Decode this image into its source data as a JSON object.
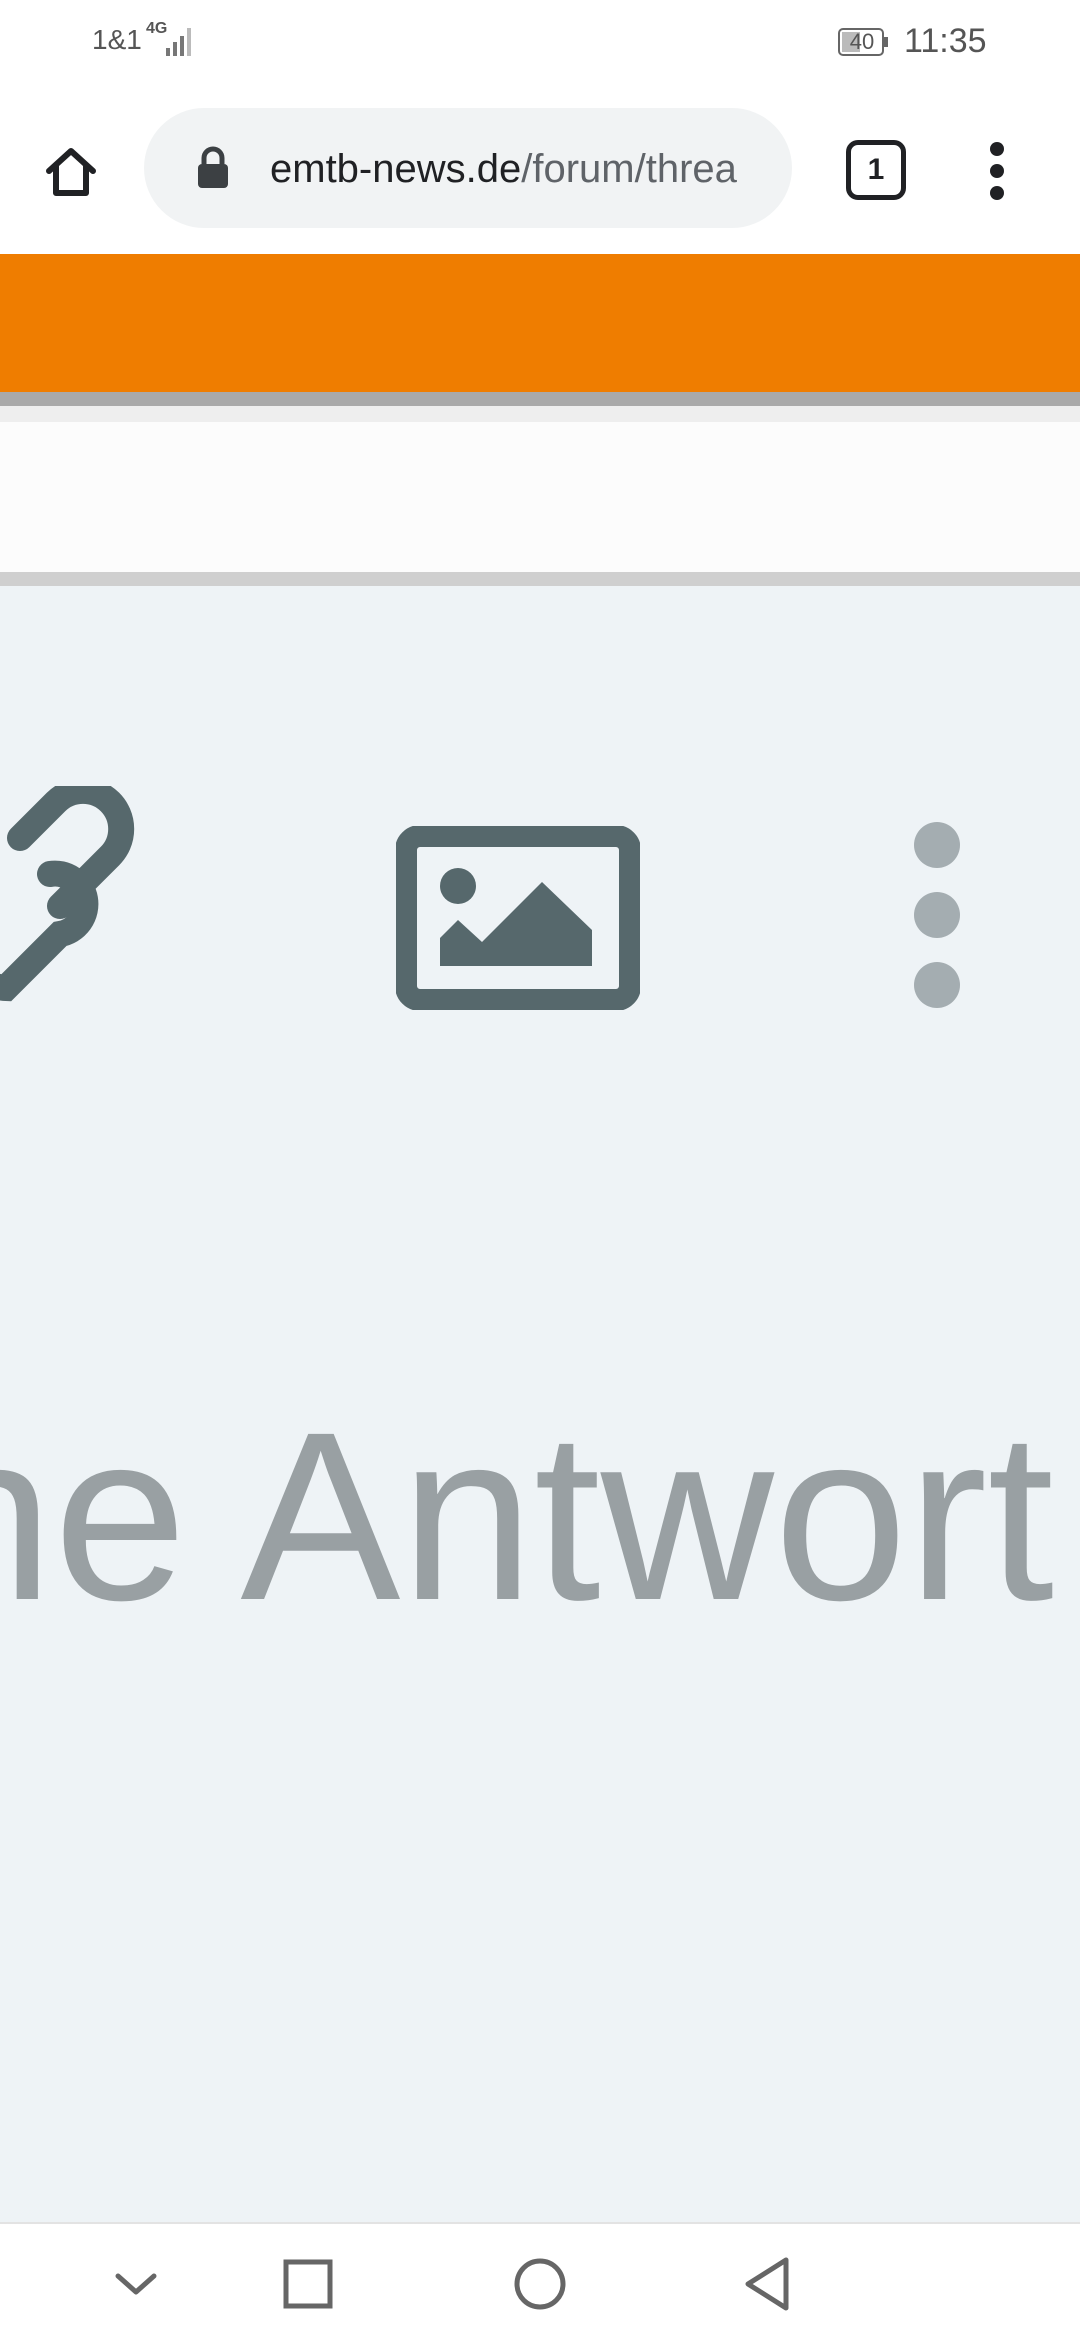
{
  "status_bar": {
    "carrier": "1&1",
    "network_type": "4G",
    "battery_level": "40",
    "time": "11:35"
  },
  "browser": {
    "url_domain": "emtb-news.de",
    "url_path": "/forum/threa",
    "tab_count": "1",
    "icons": [
      "home-icon",
      "lock-icon",
      "tab-switcher-icon",
      "overflow-menu-icon"
    ]
  },
  "colors": {
    "brand_orange": "#ef7d00",
    "editor_bg": "#eef3f6",
    "icon_dark": "#56686c",
    "placeholder_grey": "#99a0a3"
  },
  "editor": {
    "toolbar_icons": [
      "link-icon",
      "image-icon",
      "more-vertical-icon"
    ],
    "placeholder_visible": "ne Antwort"
  },
  "nav_bar": {
    "icons": [
      "hide-keyboard-icon",
      "recent-apps-icon",
      "home-circle-icon",
      "back-icon"
    ]
  }
}
